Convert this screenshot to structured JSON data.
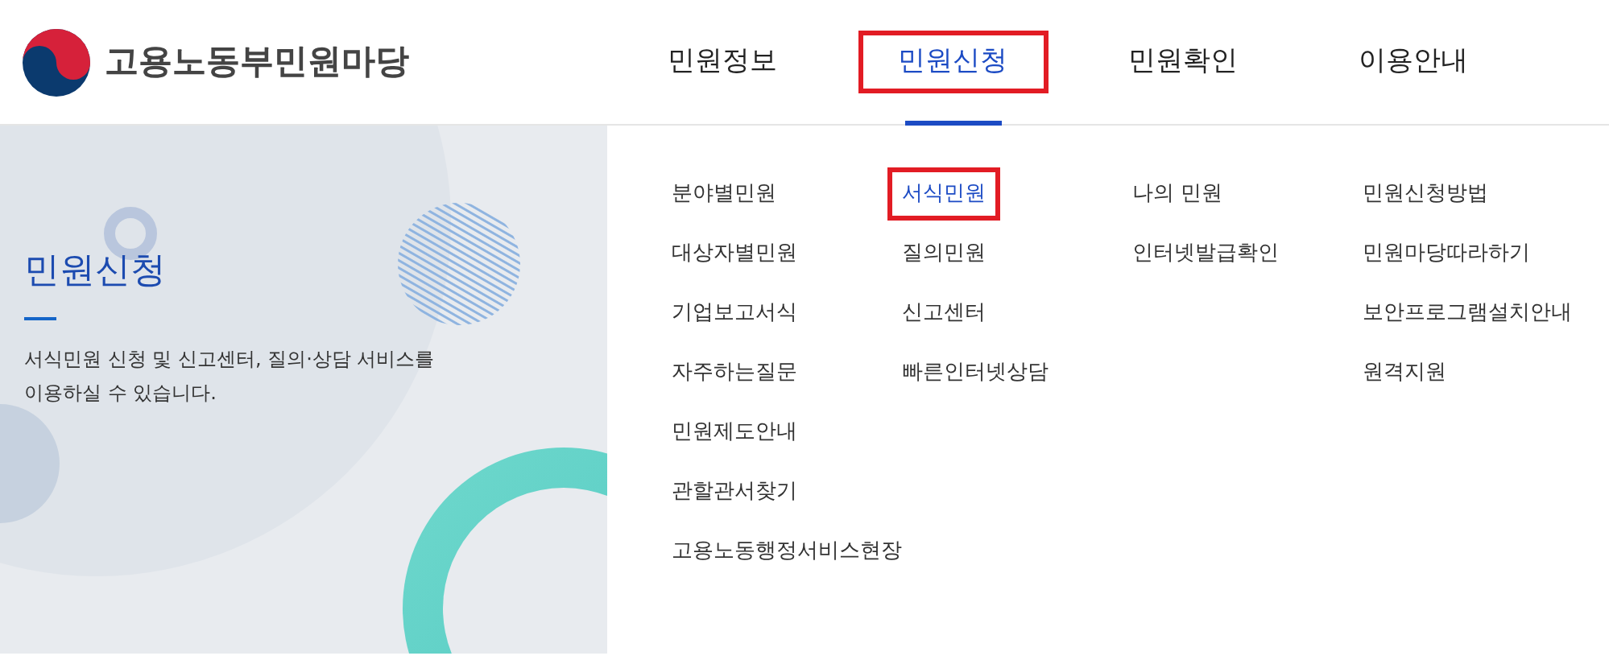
{
  "logo": {
    "title": "고용노동부민원마당"
  },
  "nav_tabs": [
    {
      "label": "민원정보",
      "selected": false
    },
    {
      "label": "민원신청",
      "selected": true
    },
    {
      "label": "민원확인",
      "selected": false
    },
    {
      "label": "이용안내",
      "selected": false
    }
  ],
  "intro": {
    "title": "민원신청",
    "description": "서식민원 신청 및 신고센터, 질의·상담 서비스를 이용하실 수 있습니다."
  },
  "menu_columns": [
    [
      {
        "label": "분야별민원",
        "selected": false
      },
      {
        "label": "대상자별민원",
        "selected": false
      },
      {
        "label": "기업보고서식",
        "selected": false
      },
      {
        "label": "자주하는질문",
        "selected": false
      },
      {
        "label": "민원제도안내",
        "selected": false
      },
      {
        "label": "관할관서찾기",
        "selected": false
      },
      {
        "label": "고용노동행정서비스현장",
        "selected": false
      }
    ],
    [
      {
        "label": "서식민원",
        "selected": true
      },
      {
        "label": "질의민원",
        "selected": false
      },
      {
        "label": "신고센터",
        "selected": false
      },
      {
        "label": "빠른인터넷상담",
        "selected": false
      }
    ],
    [
      {
        "label": "나의 민원",
        "selected": false
      },
      {
        "label": "인터넷발급확인",
        "selected": false
      }
    ],
    [
      {
        "label": "민원신청방법",
        "selected": false
      },
      {
        "label": "민원마당따라하기",
        "selected": false
      },
      {
        "label": "보안프로그램설치안내",
        "selected": false
      },
      {
        "label": "원격지원",
        "selected": false
      }
    ]
  ]
}
